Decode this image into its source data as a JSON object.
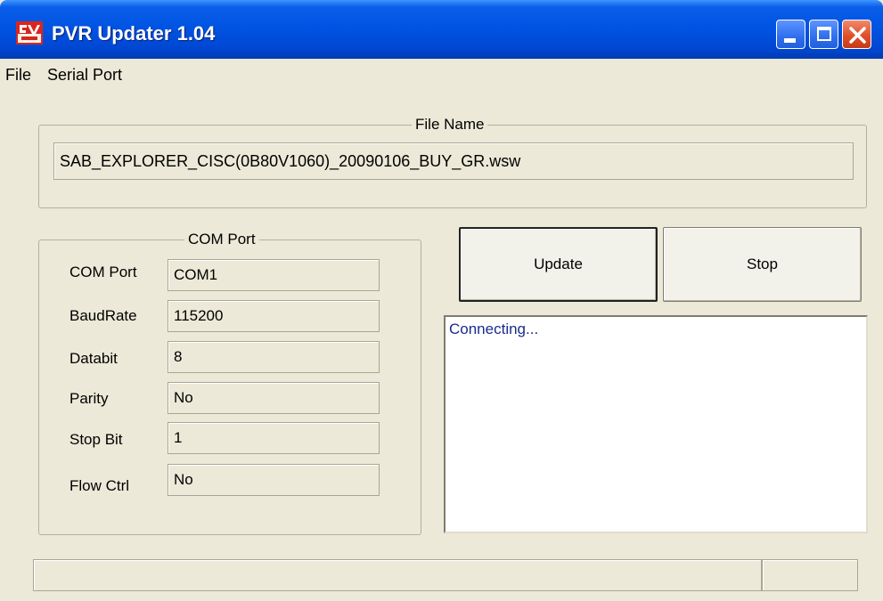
{
  "window": {
    "title": "PVR Updater 1.04",
    "title_bar_color": "#0054e3",
    "close_button_color": "#e0502a"
  },
  "menu": {
    "items": [
      {
        "label": "File"
      },
      {
        "label": "Serial Port"
      }
    ]
  },
  "file_group": {
    "caption": "File Name",
    "file_name": "SAB_EXPLORER_CISC(0B80V1060)_20090106_BUY_GR.wsw"
  },
  "com_group": {
    "caption": "COM Port",
    "fields": [
      {
        "label": "COM Port",
        "value": "COM1"
      },
      {
        "label": "BaudRate",
        "value": "115200"
      },
      {
        "label": "Databit",
        "value": "8"
      },
      {
        "label": "Parity",
        "value": "No"
      },
      {
        "label": "Stop Bit",
        "value": "1"
      },
      {
        "label": "Flow Ctrl",
        "value": "No"
      }
    ]
  },
  "actions": {
    "update_label": "Update",
    "stop_label": "Stop"
  },
  "log": {
    "text": "Connecting...",
    "text_color": "#1a2b8f"
  },
  "status": {
    "left": "",
    "right": ""
  }
}
